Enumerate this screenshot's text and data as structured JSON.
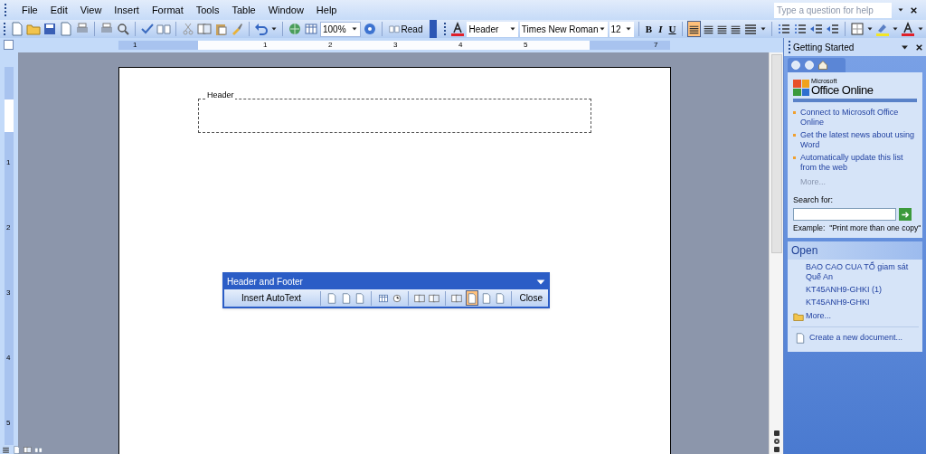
{
  "menu": [
    "File",
    "Edit",
    "View",
    "Insert",
    "Format",
    "Tools",
    "Table",
    "Window",
    "Help"
  ],
  "help_box": {
    "placeholder": "Type a question for help"
  },
  "toolbar": {
    "zoom": "100%",
    "read": "Read",
    "style": "Header",
    "font": "Times New Roman",
    "size": "12",
    "bold": "B",
    "italic": "I",
    "underline": "U",
    "alignment": [
      {
        "selected": true
      },
      {
        "selected": false
      },
      {
        "selected": false
      },
      {
        "selected": false
      }
    ]
  },
  "horizontal_ruler": [
    "1",
    "1",
    "2",
    "3",
    "4",
    "5",
    "7"
  ],
  "vertical_ruler": [
    "1",
    "2",
    "3",
    "4",
    "5"
  ],
  "document": {
    "header_label": "Header"
  },
  "header_footer_toolbar": {
    "title": "Header and Footer",
    "insert_autotext": "Insert AutoText",
    "close": "Close",
    "tools": [
      {
        "selected": false
      },
      {
        "selected": false
      },
      {
        "selected": false
      },
      {
        "selected": false
      },
      {
        "selected": false
      },
      {
        "selected": false
      },
      {
        "selected": false
      },
      {
        "selected": false
      },
      {
        "selected": true
      },
      {
        "selected": false
      },
      {
        "selected": false
      }
    ]
  },
  "task_pane": {
    "title": "Getting Started",
    "logo_small": "Microsoft",
    "logo": "Office Online",
    "links": [
      "Connect to Microsoft Office Online",
      "Get the latest news about using Word",
      "Automatically update this list from the web"
    ],
    "links_more": "More...",
    "search_label": "Search for:",
    "search_example": "Example:  \"Print more than one copy\"",
    "open_heading": "Open",
    "files": [
      "BAO CAO CUA TỔ giam sát Quế An",
      "KT45ANH9-GHKI (1)",
      "KT45ANH9-GHKI"
    ],
    "files_more": "More...",
    "create": "Create a new document..."
  }
}
